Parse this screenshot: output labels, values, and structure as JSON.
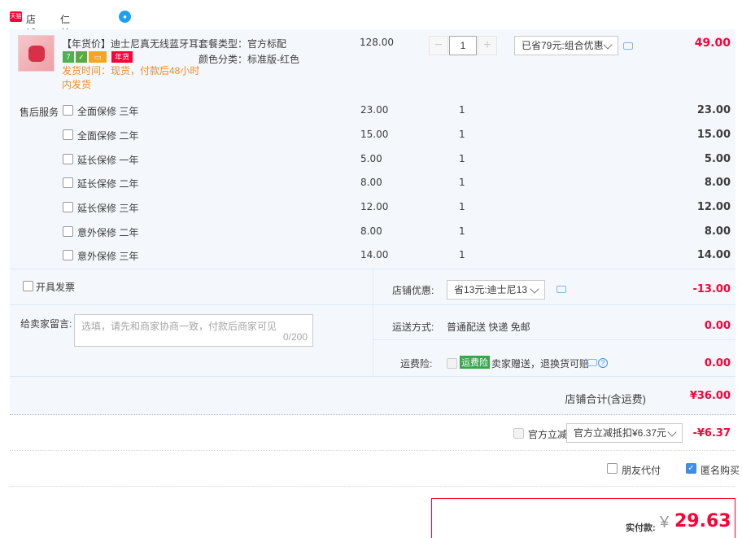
{
  "shop": {
    "label": "店铺:",
    "name": "仁美数码专营店",
    "badge": "天猫"
  },
  "item": {
    "title": "【年货价】迪士尼真无线蓝牙耳...",
    "badge_num": "7",
    "badge_tag": "年货",
    "ship_time": "发货时间：现货，付款后48小时内发货",
    "spec1": "套餐类型：官方标配",
    "spec2": "颜色分类：标准版-红色",
    "unit_price": "128.00",
    "qty": "1",
    "promo": "已省79元:组合优惠",
    "total": "49.00"
  },
  "services": {
    "label": "售后服务",
    "rows": [
      {
        "name": "全面保修 三年",
        "price": "23.00",
        "qty": "1",
        "total": "23.00"
      },
      {
        "name": "全面保修 二年",
        "price": "15.00",
        "qty": "1",
        "total": "15.00"
      },
      {
        "name": "延长保修 一年",
        "price": "5.00",
        "qty": "1",
        "total": "5.00"
      },
      {
        "name": "延长保修 二年",
        "price": "8.00",
        "qty": "1",
        "total": "8.00"
      },
      {
        "name": "延长保修 三年",
        "price": "12.00",
        "qty": "1",
        "total": "12.00"
      },
      {
        "name": "意外保修 二年",
        "price": "8.00",
        "qty": "1",
        "total": "8.00"
      },
      {
        "name": "意外保修 三年",
        "price": "14.00",
        "qty": "1",
        "total": "14.00"
      }
    ]
  },
  "invoice": {
    "label": "开具发票"
  },
  "memo": {
    "label": "给卖家留言:",
    "placeholder": "选填，请先和商家协商一致，付款后商家可见",
    "counter": "0/200"
  },
  "shop_promo": {
    "label": "店铺优惠:",
    "value": "省13元:迪士尼13",
    "amount": "-13.00"
  },
  "shipping": {
    "label": "运送方式:",
    "value": "普通配送 快递 免邮",
    "amount": "0.00"
  },
  "insurance": {
    "label": "运费险:",
    "tag": "运费险",
    "desc": "卖家赠送，退换货可赔",
    "amount": "0.00"
  },
  "subtotal": {
    "label": "店铺合计(含运费)",
    "value": "¥36.00"
  },
  "official_discount": {
    "label": "官方立减",
    "select": "官方立减抵扣¥6.37元",
    "amount": "-¥6.37"
  },
  "options": {
    "friend_pay": "朋友代付",
    "anonymous": "匿名购买"
  },
  "payment": {
    "label": "实付款:",
    "currency": "¥",
    "amount": "29.63"
  },
  "colors": {
    "accent": "#ff0036",
    "blue_bg": "#f4f8fc",
    "orange": "#ee8c2a"
  }
}
